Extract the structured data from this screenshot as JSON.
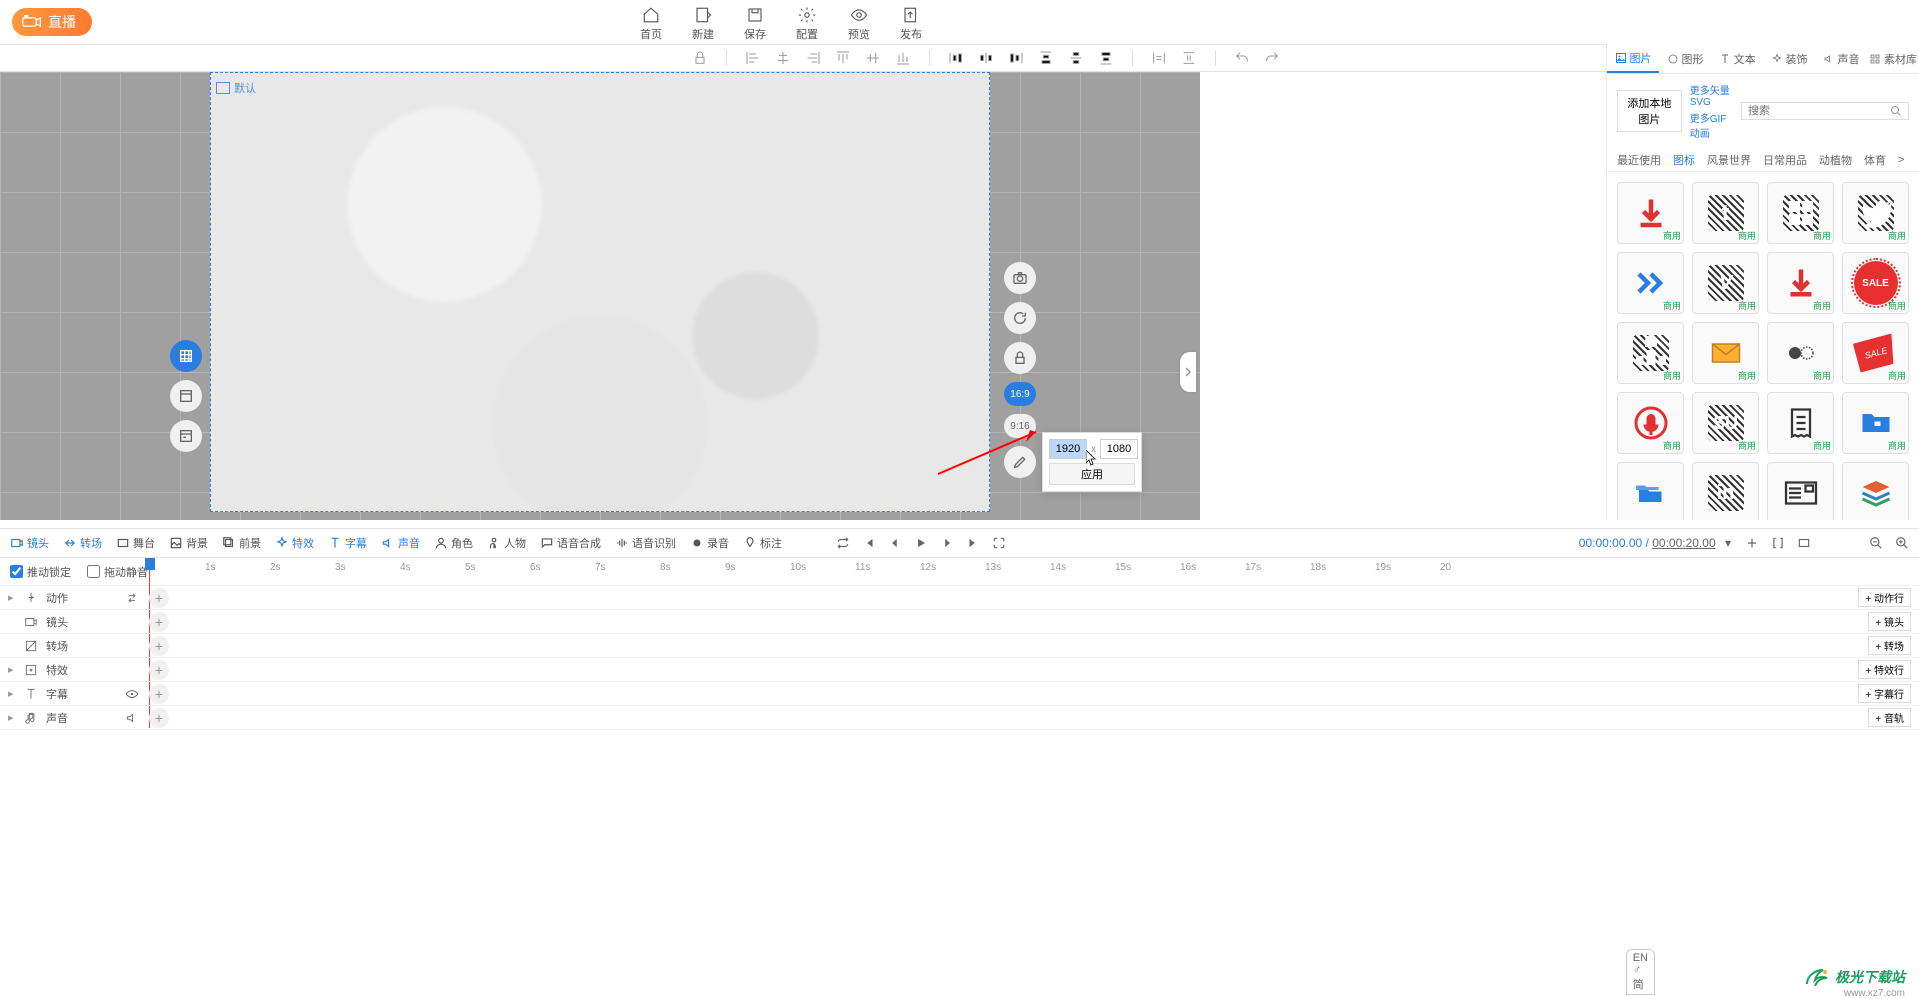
{
  "live_badge": "直播",
  "top_menu": [
    {
      "label": "首页"
    },
    {
      "label": "新建"
    },
    {
      "label": "保存"
    },
    {
      "label": "配置"
    },
    {
      "label": "预览"
    },
    {
      "label": "发布"
    }
  ],
  "canvas": {
    "layer_label": "默认",
    "ratios": {
      "r1": "16:9",
      "r2": "9:16"
    },
    "dim": {
      "w": "1920",
      "h": "1080",
      "apply": "应用",
      "x": "x"
    }
  },
  "right_panel": {
    "tabs": [
      "图片",
      "图形",
      "文本",
      "装饰",
      "声音",
      "素材库"
    ],
    "add_local": "添加本地图片",
    "more1": "更多矢量SVG",
    "more2": "更多GIF动画",
    "search_ph": "搜索",
    "cats": [
      "最近使用",
      "图标",
      "风景世界",
      "日常用品",
      "动植物",
      "体育"
    ],
    "asset_tag": "商用",
    "sale_text": "SALE"
  },
  "tl_tabs": [
    "镜头",
    "转场",
    "舞台",
    "背景",
    "前景",
    "特效",
    "字幕",
    "声音",
    "角色",
    "人物",
    "语音合成",
    "语音识别",
    "录音",
    "标注"
  ],
  "tl_time": {
    "cur": "00:00:00.00",
    "sep": " / ",
    "dur": "00:00:20.00"
  },
  "tl_opts": {
    "opt1": "推动锁定",
    "opt2": "拖动静音"
  },
  "ruler_marks": [
    "1s",
    "2s",
    "3s",
    "4s",
    "5s",
    "6s",
    "7s",
    "8s",
    "9s",
    "10s",
    "11s",
    "12s",
    "13s",
    "14s",
    "15s",
    "16s",
    "17s",
    "18s",
    "19s",
    "20"
  ],
  "tracks": [
    {
      "name": "动作",
      "tail": "动作行",
      "expand": true,
      "rightIcon": "swap"
    },
    {
      "name": "镜头",
      "tail": "镜头",
      "expand": false
    },
    {
      "name": "转场",
      "tail": "转场",
      "expand": false
    },
    {
      "name": "特效",
      "tail": "特效行",
      "expand": true
    },
    {
      "name": "字幕",
      "tail": "字幕行",
      "expand": true,
      "rightIcon": "eye"
    },
    {
      "name": "声音",
      "tail": "音轨",
      "expand": true,
      "rightIcon": "speaker"
    }
  ],
  "ime": "EN ♂ 简",
  "brand": {
    "name": "极光下载站",
    "url": "www.xz7.com"
  }
}
